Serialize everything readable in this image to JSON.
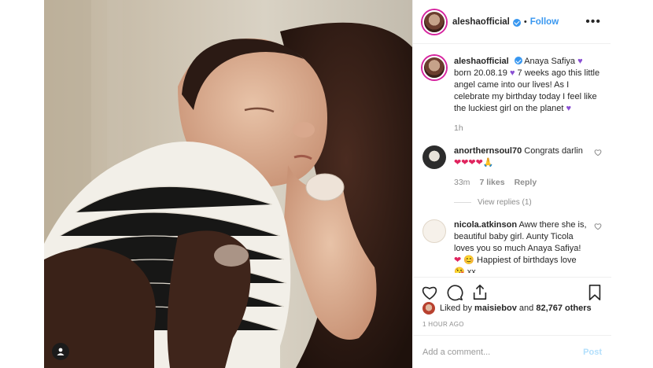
{
  "header": {
    "username": "aleshaofficial",
    "separator": "•",
    "follow_label": "Follow",
    "more_label": "•••"
  },
  "caption": {
    "username": "aleshaofficial",
    "text_1": "Anaya Safiya",
    "text_2": "born 20.08.19",
    "text_3": "7 weeks ago this little angel came into our lives! As I celebrate my birthday today I feel like the luckiest girl on the planet",
    "time": "1h"
  },
  "comments": [
    {
      "username": "anorthernsoul70",
      "text": "Congrats darlin",
      "emojis": "❤❤❤❤🙏",
      "time": "33m",
      "likes": "7 likes",
      "reply_label": "Reply",
      "view_replies": "View replies (1)"
    },
    {
      "username": "nicola.atkinson",
      "text": "Aww there she is, beautiful baby girl. Aunty Ticola loves you so much Anaya Safiya!",
      "text_2": "Happiest of birthdays love",
      "text_3": "xx"
    }
  ],
  "likes": {
    "prefix": "Liked by",
    "user": "maisiebov",
    "middle": "and",
    "count": "82,767 others"
  },
  "timestamp": "1 HOUR AGO",
  "add_comment": {
    "placeholder": "Add a comment...",
    "post_label": "Post"
  },
  "colors": {
    "accent": "#3897f0",
    "text": "#262626",
    "muted": "#8e8e8e",
    "post_disabled": "#b2dffc"
  }
}
